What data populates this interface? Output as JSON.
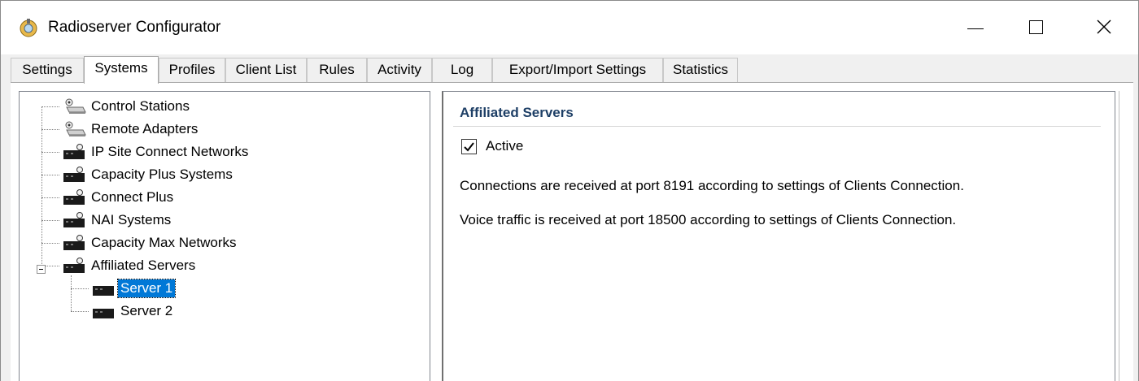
{
  "window": {
    "title": "Radioserver Configurator",
    "icon": "radio-app-icon"
  },
  "tabs": [
    {
      "label": "Settings",
      "active": false
    },
    {
      "label": "Systems",
      "active": true
    },
    {
      "label": "Profiles",
      "active": false
    },
    {
      "label": "Client List",
      "active": false
    },
    {
      "label": "Rules",
      "active": false
    },
    {
      "label": "Activity",
      "active": false
    },
    {
      "label": "Log",
      "active": false
    },
    {
      "label": "Export/Import Settings",
      "active": false
    },
    {
      "label": "Statistics",
      "active": false
    }
  ],
  "tree": {
    "items": [
      {
        "label": "Control Stations",
        "icon": "control-station-icon"
      },
      {
        "label": "Remote Adapters",
        "icon": "remote-adapter-icon"
      },
      {
        "label": "IP Site Connect Networks",
        "icon": "network-icon"
      },
      {
        "label": "Capacity Plus Systems",
        "icon": "network-icon"
      },
      {
        "label": "Connect Plus",
        "icon": "network-icon"
      },
      {
        "label": "NAI Systems",
        "icon": "network-icon"
      },
      {
        "label": "Capacity Max Networks",
        "icon": "network-icon"
      },
      {
        "label": "Affiliated Servers",
        "icon": "network-icon",
        "expanded": true
      }
    ],
    "children": [
      {
        "label": "Server 1",
        "icon": "server-icon",
        "selected": true
      },
      {
        "label": "Server 2",
        "icon": "server-icon",
        "selected": false
      }
    ]
  },
  "detail": {
    "title": "Affiliated Servers",
    "active_label": "Active",
    "active_checked": true,
    "lines": [
      "Connections are received at port 8191 according to settings of Clients Connection.",
      "Voice traffic is received at port 18500 according to settings of Clients Connection."
    ]
  },
  "colors": {
    "selection": "#0078d7",
    "section_title": "#1e3f66"
  }
}
